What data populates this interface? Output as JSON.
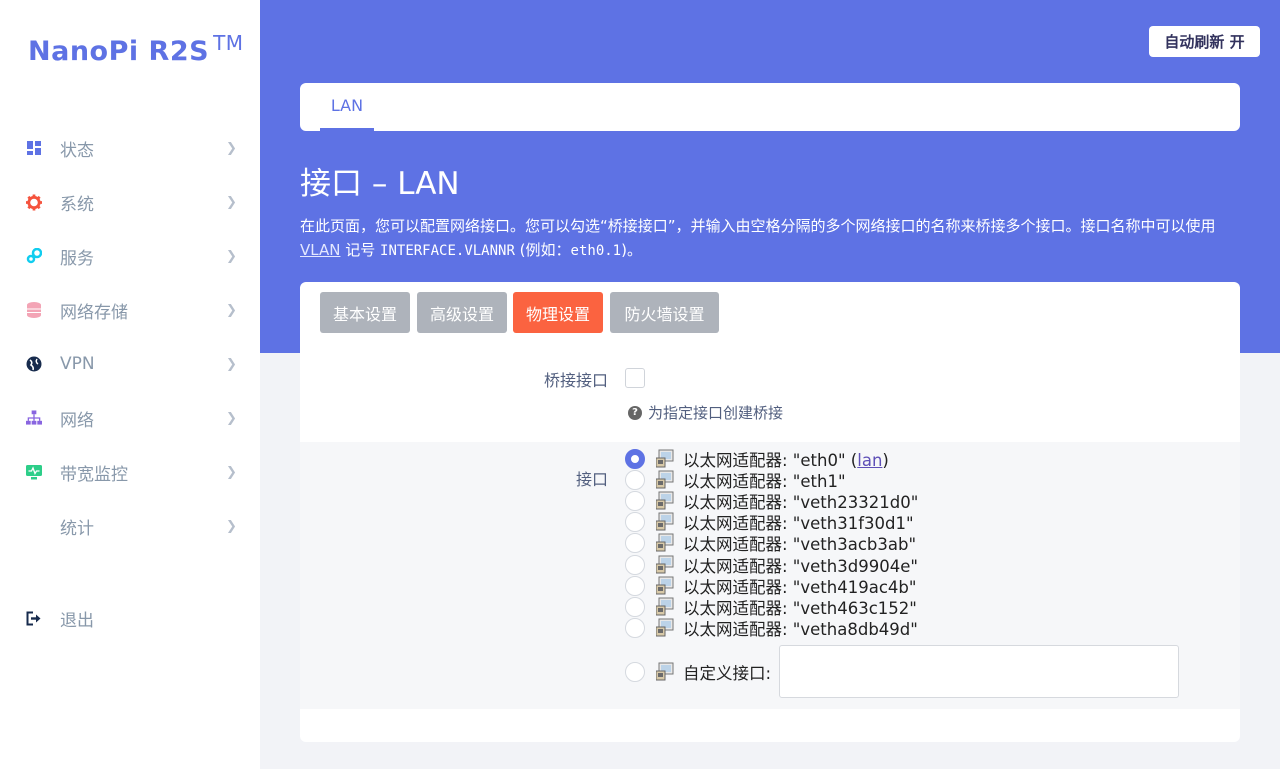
{
  "logo": {
    "text": "NanoPi R2S",
    "tm": "TM"
  },
  "sidebar": {
    "items": [
      {
        "label": "状态",
        "icon": "dashboard-icon"
      },
      {
        "label": "系统",
        "icon": "gear-icon"
      },
      {
        "label": "服务",
        "icon": "services-icon"
      },
      {
        "label": "网络存储",
        "icon": "database-icon"
      },
      {
        "label": "VPN",
        "icon": "globe-icon"
      },
      {
        "label": "网络",
        "icon": "network-icon"
      },
      {
        "label": "带宽监控",
        "icon": "monitor-icon"
      },
      {
        "label": "统计",
        "icon": ""
      }
    ],
    "logout": {
      "label": "退出",
      "icon": "logout-icon"
    }
  },
  "header": {
    "refresh_button": "自动刷新 开"
  },
  "tabs": {
    "lan": "LAN"
  },
  "page": {
    "title": "接口 – LAN",
    "desc_part1": "在此页面，您可以配置网络接口。您可以勾选“桥接接口”，并输入由空格分隔的多个网络接口的名称来桥接多个接口。接口名称中可以使用",
    "desc_link": "VLAN",
    "desc_part2": "记号",
    "desc_code": "INTERFACE.VLANNR",
    "desc_part3": "(例如：",
    "desc_example": "eth0.1",
    "desc_part4": ")。"
  },
  "settings_tabs": [
    "基本设置",
    "高级设置",
    "物理设置",
    "防火墙设置"
  ],
  "active_tab": "物理设置",
  "bridge": {
    "label": "桥接接口",
    "hint": "为指定接口创建桥接"
  },
  "interface": {
    "label": "接口",
    "options": [
      {
        "prefix": "以太网适配器: \"eth0\" (",
        "link": "lan",
        "suffix": ")",
        "checked": true
      },
      {
        "prefix": "以太网适配器: \"eth1\"",
        "link": "",
        "suffix": "",
        "checked": false
      },
      {
        "prefix": "以太网适配器: \"veth23321d0\"",
        "link": "",
        "suffix": "",
        "checked": false
      },
      {
        "prefix": "以太网适配器: \"veth31f30d1\"",
        "link": "",
        "suffix": "",
        "checked": false
      },
      {
        "prefix": "以太网适配器: \"veth3acb3ab\"",
        "link": "",
        "suffix": "",
        "checked": false
      },
      {
        "prefix": "以太网适配器: \"veth3d9904e\"",
        "link": "",
        "suffix": "",
        "checked": false
      },
      {
        "prefix": "以太网适配器: \"veth419ac4b\"",
        "link": "",
        "suffix": "",
        "checked": false
      },
      {
        "prefix": "以太网适配器: \"veth463c152\"",
        "link": "",
        "suffix": "",
        "checked": false
      },
      {
        "prefix": "以太网适配器: \"vetha8db49d\"",
        "link": "",
        "suffix": "",
        "checked": false
      }
    ],
    "custom_label": "自定义接口:",
    "custom_value": ""
  },
  "colors": {
    "primary": "#5e72e4",
    "active_tab": "#fb6340",
    "inactive_tab": "#aeb3bb"
  }
}
